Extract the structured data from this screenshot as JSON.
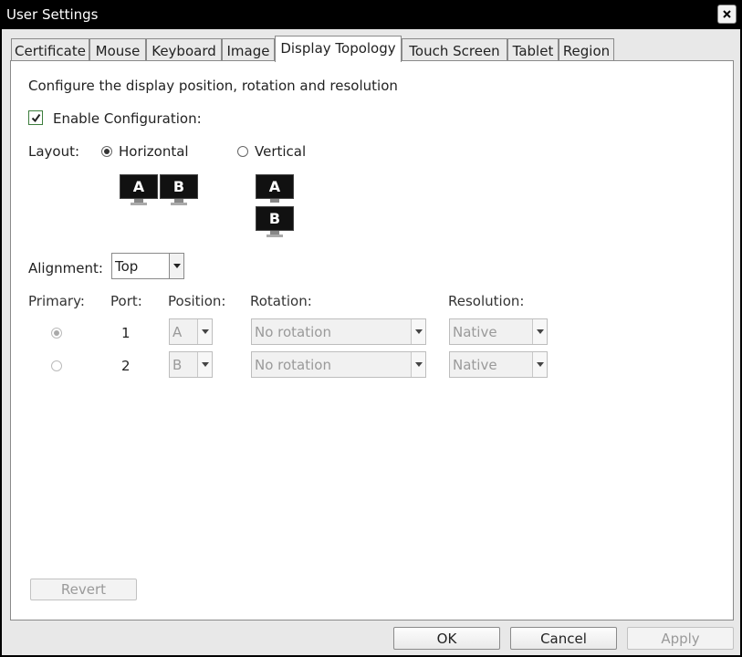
{
  "window": {
    "title": "User Settings"
  },
  "tabs": [
    "Certificate",
    "Mouse",
    "Keyboard",
    "Image",
    "Display Topology",
    "Touch Screen",
    "Tablet",
    "Region"
  ],
  "active_tab": "Display Topology",
  "content": {
    "description": "Configure the display position, rotation and resolution",
    "enable_configuration": {
      "label": "Enable Configuration:",
      "checked": true
    },
    "layout": {
      "label": "Layout:",
      "options": [
        {
          "label": "Horizontal",
          "selected": true
        },
        {
          "label": "Vertical",
          "selected": false
        }
      ],
      "monitor_labels": [
        "A",
        "B"
      ]
    },
    "alignment": {
      "label": "Alignment:",
      "value": "Top"
    },
    "table": {
      "headers": {
        "primary": "Primary:",
        "port": "Port:",
        "position": "Position:",
        "rotation": "Rotation:",
        "resolution": "Resolution:"
      },
      "rows": [
        {
          "primary": true,
          "port": "1",
          "position": "A",
          "rotation": "No rotation",
          "resolution": "Native"
        },
        {
          "primary": false,
          "port": "2",
          "position": "B",
          "rotation": "No rotation",
          "resolution": "Native"
        }
      ]
    },
    "revert_label": "Revert"
  },
  "footer": {
    "ok_label": "OK",
    "cancel_label": "Cancel",
    "apply_label": "Apply"
  },
  "icons": {
    "close": "close-icon",
    "check": "checkmark-icon",
    "dropdown": "dropdown-arrow-icon"
  }
}
